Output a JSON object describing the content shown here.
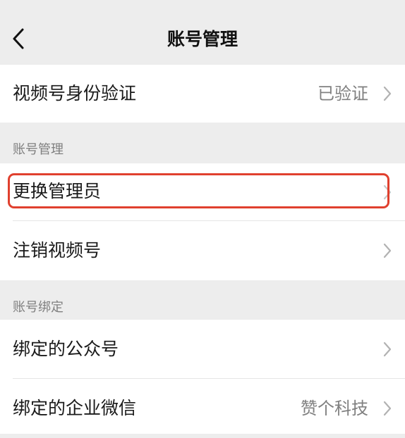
{
  "nav": {
    "title": "账号管理",
    "back_icon": "chevron-left-icon"
  },
  "identity": {
    "label": "视频号身份验证",
    "value": "已验证"
  },
  "account_section": {
    "title": "账号管理",
    "items": [
      {
        "label": "更换管理员",
        "highlighted": true
      },
      {
        "label": "注销视频号"
      }
    ]
  },
  "binding_section": {
    "title": "账号绑定",
    "items": [
      {
        "label": "绑定的公众号",
        "value": ""
      },
      {
        "label": "绑定的企业微信",
        "value": "赞个科技"
      }
    ]
  },
  "colors": {
    "background": "#ededed",
    "cell": "#ffffff",
    "secondary_text": "#808080",
    "highlight": "#e0402e"
  }
}
